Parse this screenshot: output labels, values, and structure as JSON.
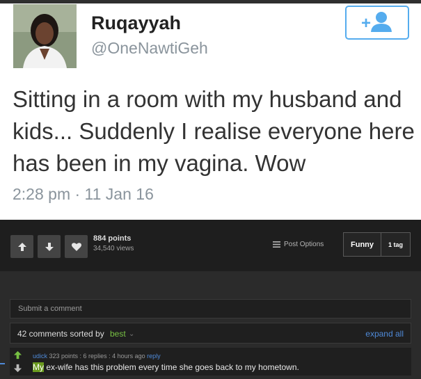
{
  "tweet": {
    "name": "Ruqayyah",
    "handle": "@OneNawtiGeh",
    "text": "Sitting in a room with my husband and kids... Suddenly I realise everyone here has been in my vagina. Wow",
    "timestamp": "2:28 pm · 11 Jan 16",
    "follow_icon": "add-user-icon",
    "accent": "#55acee"
  },
  "post": {
    "points": "884 points",
    "views": "34,540 views",
    "post_options_label": "Post Options",
    "tag_label": "Funny",
    "tag_count": "1 tag"
  },
  "comments_section": {
    "submit_placeholder": "Submit a comment",
    "count_text": "42 comments sorted by",
    "sort_value": "best",
    "expand_label": "expand all",
    "comment": {
      "username": "udick",
      "meta": " 323 points : 6 replies : 4 hours ago ",
      "reply_label": "reply",
      "highlight": "My",
      "text": " ex-wife has this problem every time she goes back to my hometown."
    }
  }
}
